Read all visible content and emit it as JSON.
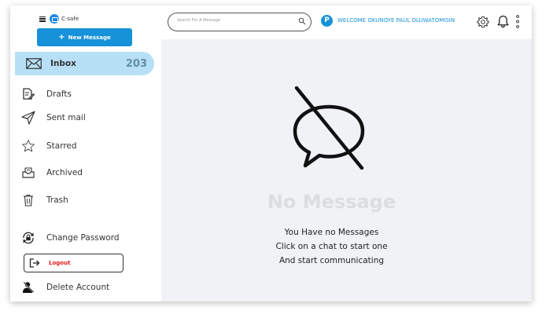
{
  "brand": {
    "name": "C-safe"
  },
  "sidebar": {
    "new_message": "New Message",
    "inbox": {
      "label": "Inbox",
      "count": "203"
    },
    "items": [
      {
        "label": "Drafts",
        "icon": "drafts-icon"
      },
      {
        "label": "Sent mail",
        "icon": "send-icon"
      },
      {
        "label": "Starred",
        "icon": "star-icon"
      },
      {
        "label": "Archived",
        "icon": "archive-icon"
      },
      {
        "label": "Trash",
        "icon": "trash-icon"
      }
    ],
    "change_password": "Change Password",
    "logout": "Logout",
    "delete_account": "Delete Account"
  },
  "header": {
    "search_placeholder": "Search For A Message",
    "avatar_initial": "P",
    "welcome": "WELCOME OKUNOYE PAUL OLUWATOMISIN"
  },
  "main": {
    "empty_title": "No Message",
    "empty_lines": [
      "You Have no Messages",
      "Click on a chat to start one",
      "And start communicating"
    ]
  },
  "colors": {
    "accent": "#1592d8",
    "inbox_bg": "#b7e0f6",
    "main_bg": "#f1f2f6",
    "logout_text": "#e01818"
  }
}
